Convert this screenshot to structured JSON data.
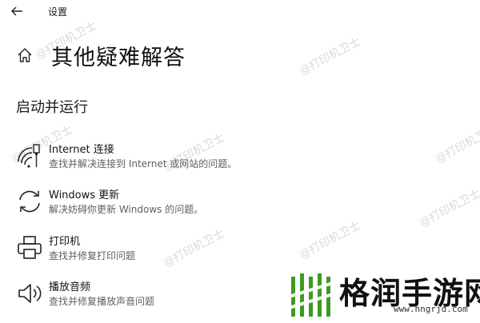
{
  "window": {
    "app_title": "设置",
    "back_icon": "arrow-left-icon"
  },
  "header": {
    "title": "其他疑难解答",
    "home_icon": "home-icon"
  },
  "section": {
    "title": "启动并运行"
  },
  "items": [
    {
      "icon": "wifi-ethernet-icon",
      "name": "Internet 连接",
      "description": "查找并解决连接到 Internet 或网站的问题。"
    },
    {
      "icon": "sync-icon",
      "name": "Windows 更新",
      "description": "解决妨碍你更新 Windows 的问题。"
    },
    {
      "icon": "printer-icon",
      "name": "打印机",
      "description": "查找并修复打印问题"
    },
    {
      "icon": "speaker-icon",
      "name": "播放音频",
      "description": "查找并修复播放声音问题"
    }
  ],
  "watermark": {
    "text": "@打印机卫士"
  },
  "brand": {
    "name": "格润手游网",
    "url": "www.hngrjd.com",
    "accent": "#3e9a1f"
  },
  "colors": {
    "text": "#1b1b1b",
    "secondary_text": "#5f5f5f",
    "background": "#ffffff"
  }
}
